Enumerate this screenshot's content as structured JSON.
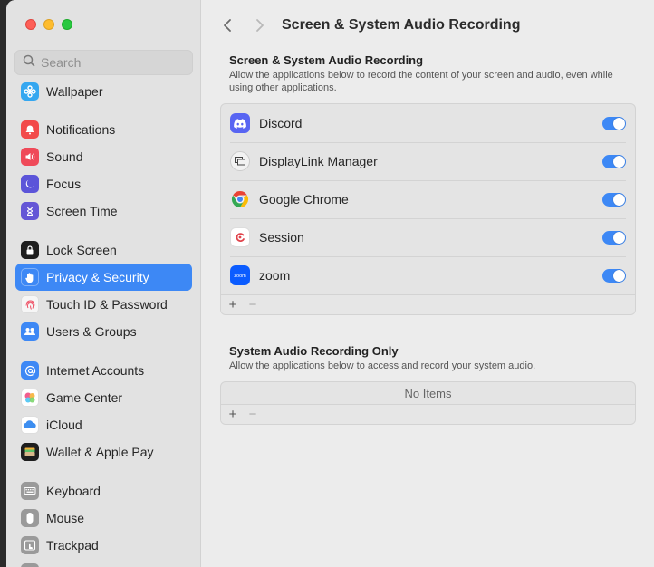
{
  "window": {
    "title": "Screen & System Audio Recording"
  },
  "sidebar": {
    "search_placeholder": "Search",
    "items": [
      {
        "label": "Wallpaper",
        "icon": "wallpaper-icon",
        "color": "#35a7f0"
      },
      {
        "label": "Notifications",
        "icon": "bell-icon",
        "color": "#f24a4a"
      },
      {
        "label": "Sound",
        "icon": "speaker-icon",
        "color": "#ef4a59"
      },
      {
        "label": "Focus",
        "icon": "moon-icon",
        "color": "#5c55d9"
      },
      {
        "label": "Screen Time",
        "icon": "hourglass-icon",
        "color": "#6456d6"
      },
      {
        "label": "Lock Screen",
        "icon": "lock-icon",
        "color": "#1e1e1e"
      },
      {
        "label": "Privacy & Security",
        "icon": "hand-icon",
        "color": "#3d88f5"
      },
      {
        "label": "Touch ID & Password",
        "icon": "fingerprint-icon",
        "color": "#f6f6f6"
      },
      {
        "label": "Users & Groups",
        "icon": "users-icon",
        "color": "#3d88f5"
      },
      {
        "label": "Internet Accounts",
        "icon": "at-icon",
        "color": "#3d88f5"
      },
      {
        "label": "Game Center",
        "icon": "game-center-icon",
        "color": "#ffffff"
      },
      {
        "label": "iCloud",
        "icon": "cloud-icon",
        "color": "#ffffff"
      },
      {
        "label": "Wallet & Apple Pay",
        "icon": "wallet-icon",
        "color": "#1e1e1e"
      },
      {
        "label": "Keyboard",
        "icon": "keyboard-icon",
        "color": "#9a9a9a"
      },
      {
        "label": "Mouse",
        "icon": "mouse-icon",
        "color": "#9a9a9a"
      },
      {
        "label": "Trackpad",
        "icon": "trackpad-icon",
        "color": "#9a9a9a"
      }
    ],
    "active_label": "Privacy & Security"
  },
  "section1": {
    "title": "Screen & System Audio Recording",
    "description": "Allow the applications below to record the content of your screen and audio, even while using other applications.",
    "apps": [
      {
        "name": "Discord",
        "icon": "discord-icon",
        "enabled": true
      },
      {
        "name": "DisplayLink Manager",
        "icon": "displaylink-icon",
        "enabled": true
      },
      {
        "name": "Google Chrome",
        "icon": "chrome-icon",
        "enabled": true
      },
      {
        "name": "Session",
        "icon": "session-icon",
        "enabled": true
      },
      {
        "name": "zoom",
        "icon": "zoom-icon",
        "enabled": true
      }
    ],
    "add_label": "+",
    "remove_label": "−"
  },
  "section2": {
    "title": "System Audio Recording Only",
    "description": "Allow the applications below to access and record your system audio.",
    "empty_text": "No Items",
    "add_label": "+",
    "remove_label": "−"
  },
  "colors": {
    "accent": "#3d88f5"
  }
}
